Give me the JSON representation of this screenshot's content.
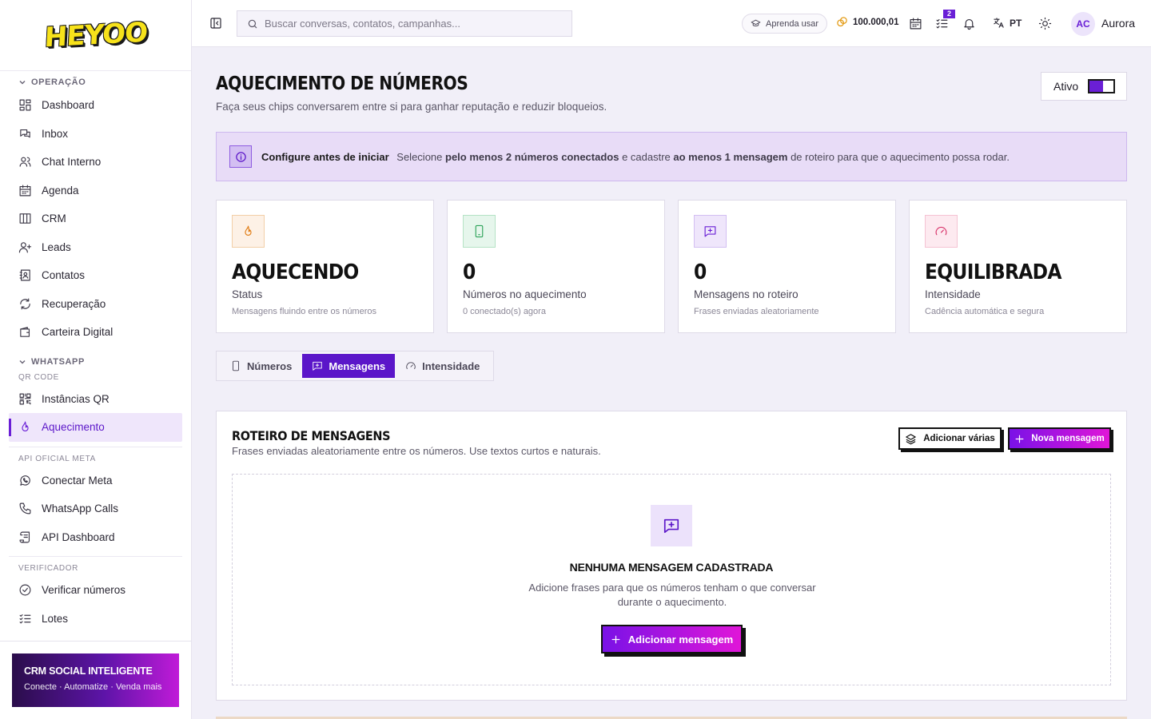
{
  "brand": {
    "logo_text": "HEYOO"
  },
  "sidebar": {
    "section_operacao": "OPERAÇÃO",
    "operacao_items": [
      {
        "label": "Dashboard",
        "icon": "dashboard-icon"
      },
      {
        "label": "Inbox",
        "icon": "inbox-icon"
      },
      {
        "label": "Chat Interno",
        "icon": "users-icon"
      },
      {
        "label": "Agenda",
        "icon": "calendar-icon"
      },
      {
        "label": "CRM",
        "icon": "kanban-icon"
      },
      {
        "label": "Leads",
        "icon": "user-plus-icon"
      },
      {
        "label": "Contatos",
        "icon": "contact-book-icon"
      },
      {
        "label": "Recuperação",
        "icon": "refresh-icon"
      },
      {
        "label": "Carteira Digital",
        "icon": "wallet-icon"
      }
    ],
    "section_whatsapp": "WHATSAPP",
    "sub_qr": "QR CODE",
    "qr_items": [
      {
        "label": "Instâncias QR",
        "icon": "qr-code-icon"
      },
      {
        "label": "Aquecimento",
        "icon": "flame-icon",
        "active": true
      }
    ],
    "sub_api": "API OFICIAL META",
    "api_items": [
      {
        "label": "Conectar Meta",
        "icon": "whatsapp-icon"
      },
      {
        "label": "WhatsApp Calls",
        "icon": "phone-icon"
      },
      {
        "label": "API Dashboard",
        "icon": "scroll-icon"
      }
    ],
    "sub_verificador": "VERIFICADOR",
    "verificador_items": [
      {
        "label": "Verificar números",
        "icon": "check-circle-icon"
      },
      {
        "label": "Lotes",
        "icon": "list-checks-icon"
      }
    ],
    "promo": {
      "title": "CRM SOCIAL INTELIGENTE",
      "subtitle": "Conecte · Automatize · Venda mais"
    }
  },
  "topbar": {
    "search_placeholder": "Buscar conversas, contatos, campanhas...",
    "learn_label": "Aprenda usar",
    "coins": "100.000,01",
    "tasks_badge": "2",
    "language": "PT",
    "user_initials": "AC",
    "user_name": "Aurora"
  },
  "page": {
    "title": "AQUECIMENTO DE NÚMEROS",
    "subtitle": "Faça seus chips conversarem entre si para ganhar reputação e reduzir bloqueios.",
    "toggle_label": "Ativo",
    "toggle_on": true
  },
  "alert": {
    "heading": "Configure antes de iniciar",
    "text_1": "Selecione ",
    "bold_1": "pelo menos 2 números conectados",
    "text_2": " e cadastre ",
    "bold_2": "ao menos 1 mensagem",
    "text_3": " de roteiro para que o aquecimento possa rodar."
  },
  "stats": [
    {
      "value": "AQUECENDO",
      "label": "Status",
      "sub": "Mensagens fluindo entre os números",
      "icon": "flame-icon",
      "bg": "#fdf1e6",
      "border": "#f3cfa7",
      "stroke": "#e07b12"
    },
    {
      "value": "0",
      "label": "Números no aquecimento",
      "sub": "0 conectado(s) agora",
      "icon": "smartphone-icon",
      "bg": "#e6f6ec",
      "border": "#b5e3c5",
      "stroke": "#2ea35a"
    },
    {
      "value": "0",
      "label": "Mensagens no roteiro",
      "sub": "Frases enviadas aleatoriamente",
      "icon": "message-plus-icon",
      "bg": "#efe6fb",
      "border": "#d3bff2",
      "stroke": "#6a1fd6"
    },
    {
      "value": "EQUILIBRADA",
      "label": "Intensidade",
      "sub": "Cadência automática e segura",
      "icon": "gauge-icon",
      "bg": "#fdeaf0",
      "border": "#f5c3d3",
      "stroke": "#d8336a"
    }
  ],
  "tabs": [
    {
      "label": "Números",
      "icon": "smartphone-icon"
    },
    {
      "label": "Mensagens",
      "icon": "message-plus-icon",
      "active": true
    },
    {
      "label": "Intensidade",
      "icon": "gauge-icon"
    }
  ],
  "panel": {
    "title": "ROTEIRO DE MENSAGENS",
    "subtitle": "Frases enviadas aleatoriamente entre os números. Use textos curtos e naturais.",
    "btn_add_many": "Adicionar várias",
    "btn_new": "Nova mensagem",
    "empty_title": "NENHUMA MENSAGEM CADASTRADA",
    "empty_text": "Adicione frases para que os números tenham o que conversar durante o aquecimento.",
    "empty_button": "Adicionar mensagem"
  },
  "colors": {
    "accent": "#6a1fd6",
    "gradient_start": "#7a12e6",
    "gradient_end": "#e016d8"
  }
}
